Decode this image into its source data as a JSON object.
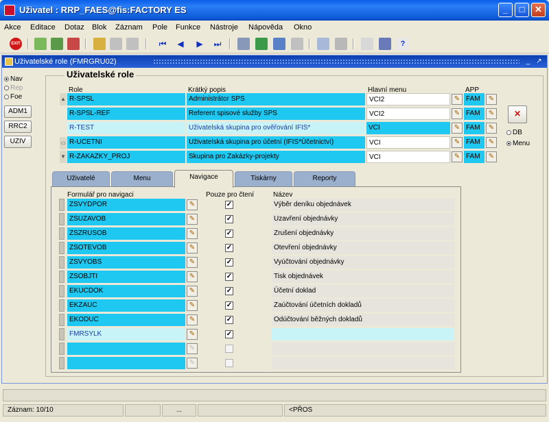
{
  "window": {
    "title": "Uživatel : RRP_FAES@fis:FACTORY ES"
  },
  "menu": [
    "Akce",
    "Editace",
    "Dotaz",
    "Blok",
    "Záznam",
    "Pole",
    "Funkce",
    "Nástroje",
    "Nápověda",
    "Okno"
  ],
  "toolbar": {
    "exit_label": "EXIT"
  },
  "frame": {
    "title": "Uživatelské role (FMRGRU02)"
  },
  "mode_radios": [
    {
      "label": "Nav",
      "selected": true,
      "enabled": true
    },
    {
      "label": "Rep",
      "selected": false,
      "enabled": false
    },
    {
      "label": "Foe",
      "selected": false,
      "enabled": true
    }
  ],
  "side_buttons": [
    "ADM1",
    "RRC2",
    "UZIV"
  ],
  "roles": {
    "heading": "Uživatelské role",
    "columns": {
      "role": "Role",
      "popis": "Krátký popis",
      "menu": "Hlavní menu",
      "app": "APP"
    },
    "rows": [
      {
        "role": "R-SPSL",
        "popis": "Administrátor SPS",
        "menu": "VCI2",
        "app": "FAM"
      },
      {
        "role": "R-SPSL-REF",
        "popis": "Referent spisové služby SPS",
        "menu": "VCI2",
        "app": "FAM"
      },
      {
        "role": "R-TEST",
        "popis": "Uživatelská skupina pro ověřování IFIS*",
        "menu": "VCI",
        "app": "FAM"
      },
      {
        "role": "R-UCETNI",
        "popis": "Uživatelská skupina pro účetní (IFIS*Účetnictví)",
        "menu": "VCI",
        "app": "FAM"
      },
      {
        "role": "R-ZAKAZKY_PROJ",
        "popis": "Skupina pro Zakázky-projekty",
        "menu": "VCI",
        "app": "FAM"
      }
    ],
    "selected_row": 2
  },
  "db_menu_radios": [
    {
      "label": "DB",
      "selected": false
    },
    {
      "label": "Menu",
      "selected": true
    }
  ],
  "tabs": [
    "Uživatelé",
    "Menu",
    "Navigace",
    "Tiskárny",
    "Reporty"
  ],
  "active_tab": 2,
  "navigation": {
    "columns": {
      "form": "Formulář pro navigaci",
      "readonly": "Pouze pro čtení",
      "name": "Název"
    },
    "rows": [
      {
        "form": "ZSVYDPOR",
        "readonly": true,
        "name": "Výběr deníku objednávek"
      },
      {
        "form": "ZSUZAVOB",
        "readonly": true,
        "name": "Uzavření objednávky"
      },
      {
        "form": "ZSZRUSOB",
        "readonly": true,
        "name": "Zrušení objednávky"
      },
      {
        "form": "ZSOTEVOB",
        "readonly": true,
        "name": "Otevření objednávky"
      },
      {
        "form": "ZSVYOBS",
        "readonly": true,
        "name": "Vyúčtování objednávky"
      },
      {
        "form": "ZSOBJTI",
        "readonly": true,
        "name": "Tisk objednávek"
      },
      {
        "form": "EKUCDOK",
        "readonly": true,
        "name": "Účetní doklad"
      },
      {
        "form": "EKZAUC",
        "readonly": true,
        "name": "Zaúčtování účetních dokladů"
      },
      {
        "form": "EKODUC",
        "readonly": true,
        "name": "Odúčtování běžných dokladů"
      },
      {
        "form": "FMRSYLK",
        "readonly": true,
        "name": ""
      },
      {
        "form": "",
        "readonly": false,
        "name": ""
      },
      {
        "form": "",
        "readonly": false,
        "name": ""
      }
    ],
    "current_row": 9
  },
  "status": {
    "record": "Záznam: 10/10",
    "dots": "...",
    "mode": "<PŘOS"
  }
}
